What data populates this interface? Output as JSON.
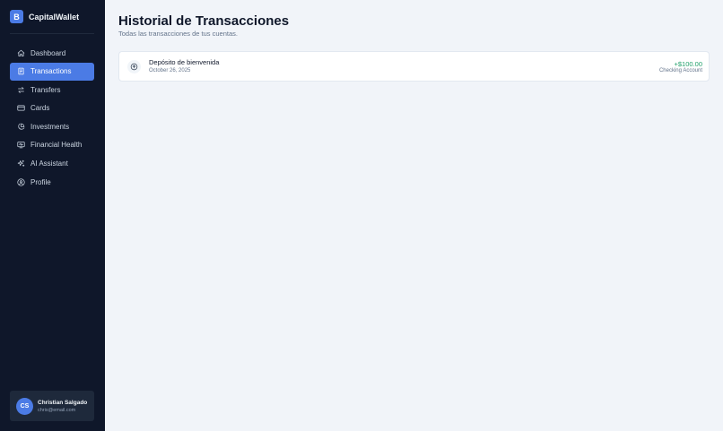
{
  "app": {
    "logo_letter": "B",
    "name": "CapitalWallet",
    "accent_color": "#4b7be5",
    "sidebar_color": "#0f172a"
  },
  "sidebar": {
    "items": [
      {
        "label": "Dashboard",
        "icon": "home-icon",
        "active": false
      },
      {
        "label": "Transactions",
        "icon": "receipt-icon",
        "active": true
      },
      {
        "label": "Transfers",
        "icon": "arrows-exchange-icon",
        "active": false
      },
      {
        "label": "Cards",
        "icon": "credit-card-icon",
        "active": false
      },
      {
        "label": "Investments",
        "icon": "pie-chart-icon",
        "active": false
      },
      {
        "label": "Financial Health",
        "icon": "monitor-heart-icon",
        "active": false
      },
      {
        "label": "AI Assistant",
        "icon": "sparkles-icon",
        "active": false
      },
      {
        "label": "Profile",
        "icon": "user-circle-icon",
        "active": false
      }
    ]
  },
  "user": {
    "initials": "CS",
    "name": "Christian Salgado",
    "email": "chris@email.com"
  },
  "main": {
    "title": "Historial de Transacciones",
    "subtitle": "Todas las transacciones de tus cuentas.",
    "transactions": [
      {
        "icon": "arrow-up-circle-icon",
        "description": "Depósito de bienvenida",
        "date": "October 26, 2025",
        "amount": "+$100.00",
        "account": "Checking Account",
        "amount_color": "#22a06b"
      }
    ]
  }
}
